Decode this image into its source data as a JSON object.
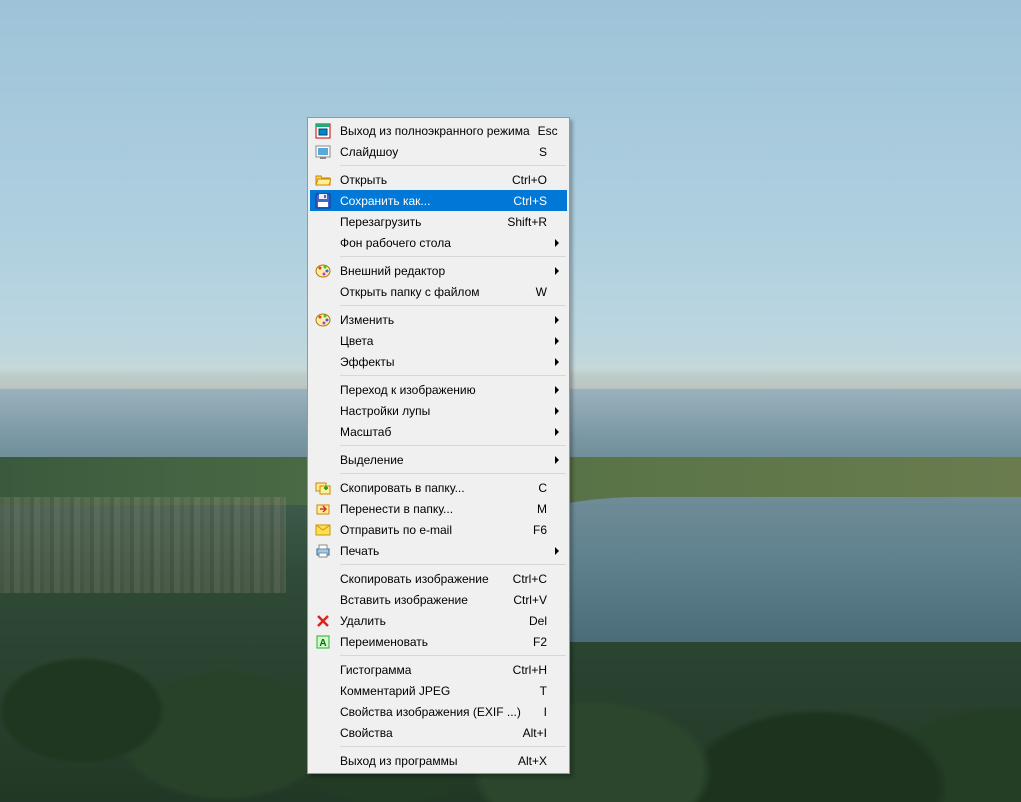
{
  "menu": {
    "groups": [
      [
        {
          "id": "exit-fullscreen",
          "icon": "fullscreen-exit",
          "label": "Выход из полноэкранного режима",
          "shortcut": "Esc"
        },
        {
          "id": "slideshow",
          "icon": "slideshow",
          "label": "Слайдшоу",
          "shortcut": "S"
        }
      ],
      [
        {
          "id": "open",
          "icon": "folder-open",
          "label": "Открыть",
          "shortcut": "Ctrl+O"
        },
        {
          "id": "save-as",
          "icon": "save",
          "label": "Сохранить как...",
          "shortcut": "Ctrl+S",
          "selected": true
        },
        {
          "id": "reload",
          "icon": "",
          "label": "Перезагрузить",
          "shortcut": "Shift+R"
        },
        {
          "id": "desktop-background",
          "icon": "",
          "label": "Фон рабочего стола",
          "submenu": true
        }
      ],
      [
        {
          "id": "external-editor",
          "icon": "palette",
          "label": "Внешний редактор",
          "submenu": true
        },
        {
          "id": "open-folder",
          "icon": "",
          "label": "Открыть папку с файлом",
          "shortcut": "W"
        }
      ],
      [
        {
          "id": "edit",
          "icon": "palette",
          "label": "Изменить",
          "submenu": true
        },
        {
          "id": "colors",
          "icon": "",
          "label": "Цвета",
          "submenu": true
        },
        {
          "id": "effects",
          "icon": "",
          "label": "Эффекты",
          "submenu": true
        }
      ],
      [
        {
          "id": "goto-image",
          "icon": "",
          "label": "Переход к изображению",
          "submenu": true
        },
        {
          "id": "loupe-settings",
          "icon": "",
          "label": "Настройки лупы",
          "submenu": true
        },
        {
          "id": "zoom",
          "icon": "",
          "label": "Масштаб",
          "submenu": true
        }
      ],
      [
        {
          "id": "selection",
          "icon": "",
          "label": "Выделение",
          "submenu": true
        }
      ],
      [
        {
          "id": "copy-to-folder",
          "icon": "copy-folder",
          "label": "Скопировать в папку...",
          "shortcut": "C"
        },
        {
          "id": "move-to-folder",
          "icon": "move-folder",
          "label": "Перенести в папку...",
          "shortcut": "M"
        },
        {
          "id": "send-email",
          "icon": "email",
          "label": "Отправить по e-mail",
          "shortcut": "F6"
        },
        {
          "id": "print",
          "icon": "printer",
          "label": "Печать",
          "submenu": true
        }
      ],
      [
        {
          "id": "copy-image",
          "icon": "",
          "label": "Скопировать изображение",
          "shortcut": "Ctrl+C"
        },
        {
          "id": "paste-image",
          "icon": "",
          "label": "Вставить изображение",
          "shortcut": "Ctrl+V"
        },
        {
          "id": "delete",
          "icon": "delete",
          "label": "Удалить",
          "shortcut": "Del"
        },
        {
          "id": "rename",
          "icon": "rename",
          "label": "Переименовать",
          "shortcut": "F2"
        }
      ],
      [
        {
          "id": "histogram",
          "icon": "",
          "label": "Гистограмма",
          "shortcut": "Ctrl+H"
        },
        {
          "id": "jpeg-comment",
          "icon": "",
          "label": "Комментарий JPEG",
          "shortcut": "T"
        },
        {
          "id": "image-properties",
          "icon": "",
          "label": "Свойства изображения (EXIF ...)",
          "shortcut": "I"
        },
        {
          "id": "properties",
          "icon": "",
          "label": "Свойства",
          "shortcut": "Alt+I"
        }
      ],
      [
        {
          "id": "exit",
          "icon": "",
          "label": "Выход из программы",
          "shortcut": "Alt+X"
        }
      ]
    ]
  }
}
